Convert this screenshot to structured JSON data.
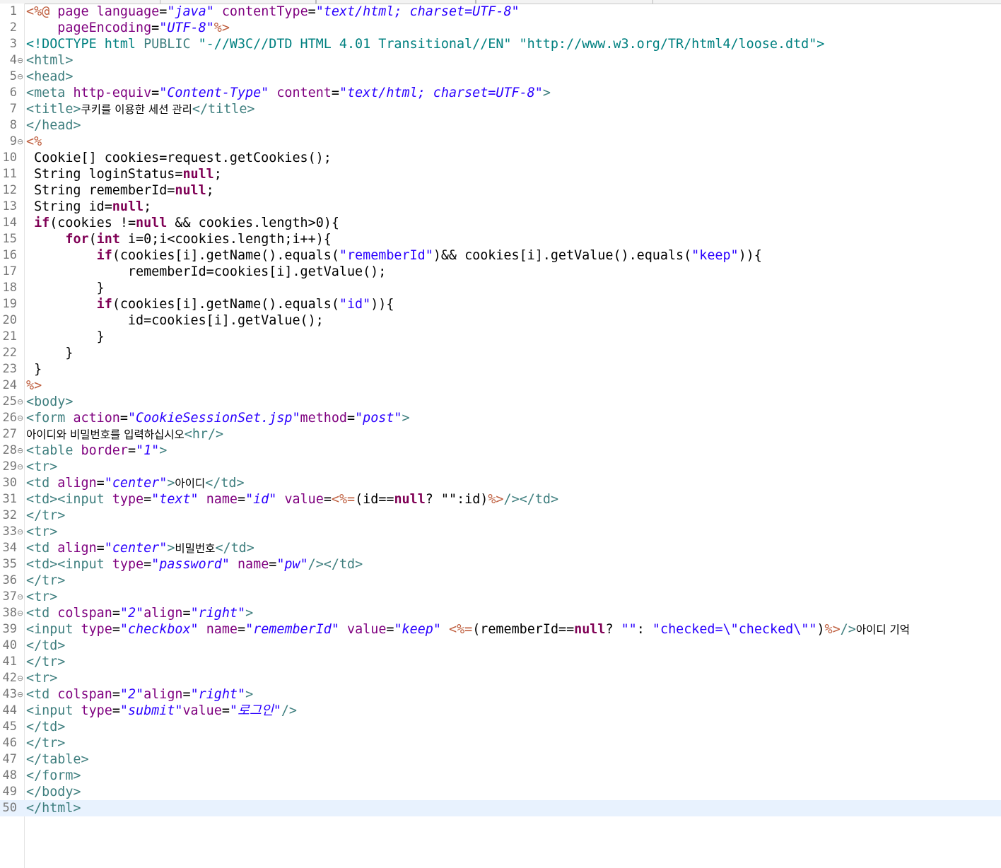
{
  "editor": {
    "lines": [
      {
        "n": "1",
        "fold": "",
        "segs": [
          [
            "j",
            "<%@"
          ],
          [
            "p",
            " "
          ],
          [
            "a",
            "page"
          ],
          [
            "p",
            " "
          ],
          [
            "a",
            "language"
          ],
          [
            "p",
            "="
          ],
          [
            "v",
            "\"java\""
          ],
          [
            "p",
            " "
          ],
          [
            "a",
            "contentType"
          ],
          [
            "p",
            "="
          ],
          [
            "v",
            "\"text/html; charset=UTF-8\""
          ]
        ]
      },
      {
        "n": "2",
        "fold": "",
        "segs": [
          [
            "p",
            "    "
          ],
          [
            "a",
            "pageEncoding"
          ],
          [
            "p",
            "="
          ],
          [
            "v",
            "\"UTF-8\""
          ],
          [
            "j",
            "%>"
          ]
        ]
      },
      {
        "n": "3",
        "fold": "",
        "segs": [
          [
            "d",
            "<!DOCTYPE html "
          ],
          [
            "t",
            "PUBLIC"
          ],
          [
            "d",
            " \"-//W3C//DTD HTML 4.01 Transitional//EN\" \"http://www.w3.org/TR/html4/loose.dtd\">"
          ]
        ]
      },
      {
        "n": "4",
        "fold": "⊖",
        "segs": [
          [
            "t",
            "<html>"
          ]
        ]
      },
      {
        "n": "5",
        "fold": "⊖",
        "segs": [
          [
            "t",
            "<head>"
          ]
        ]
      },
      {
        "n": "6",
        "fold": "",
        "segs": [
          [
            "t",
            "<meta "
          ],
          [
            "a",
            "http-equiv"
          ],
          [
            "p",
            "="
          ],
          [
            "v",
            "\"Content-Type\""
          ],
          [
            "p",
            " "
          ],
          [
            "a",
            "content"
          ],
          [
            "p",
            "="
          ],
          [
            "v",
            "\"text/html; charset=UTF-8\""
          ],
          [
            "t",
            ">"
          ]
        ]
      },
      {
        "n": "7",
        "fold": "",
        "segs": [
          [
            "t",
            "<title>"
          ],
          [
            "x",
            "쿠키를 이용한 세션 관리"
          ],
          [
            "t",
            "</title>"
          ]
        ]
      },
      {
        "n": "8",
        "fold": "",
        "segs": [
          [
            "t",
            "</head>"
          ]
        ]
      },
      {
        "n": "9",
        "fold": "⊖",
        "segs": [
          [
            "j",
            "<%"
          ]
        ]
      },
      {
        "n": "10",
        "fold": "",
        "segs": [
          [
            "p",
            " Cookie[] cookies=request.getCookies();"
          ]
        ]
      },
      {
        "n": "11",
        "fold": "",
        "segs": [
          [
            "p",
            " String loginStatus="
          ],
          [
            "k",
            "null"
          ],
          [
            "p",
            ";"
          ]
        ]
      },
      {
        "n": "12",
        "fold": "",
        "segs": [
          [
            "p",
            " String rememberId="
          ],
          [
            "k",
            "null"
          ],
          [
            "p",
            ";"
          ]
        ]
      },
      {
        "n": "13",
        "fold": "",
        "segs": [
          [
            "p",
            " String id="
          ],
          [
            "k",
            "null"
          ],
          [
            "p",
            ";"
          ]
        ]
      },
      {
        "n": "14",
        "fold": "",
        "segs": [
          [
            "p",
            " "
          ],
          [
            "k",
            "if"
          ],
          [
            "p",
            "(cookies !="
          ],
          [
            "k",
            "null"
          ],
          [
            "p",
            " && cookies.length>0){"
          ]
        ]
      },
      {
        "n": "15",
        "fold": "",
        "segs": [
          [
            "p",
            "     "
          ],
          [
            "k",
            "for"
          ],
          [
            "p",
            "("
          ],
          [
            "k",
            "int"
          ],
          [
            "p",
            " i=0;i<cookies.length;i++){"
          ]
        ]
      },
      {
        "n": "16",
        "fold": "",
        "segs": [
          [
            "p",
            "         "
          ],
          [
            "k",
            "if"
          ],
          [
            "p",
            "(cookies[i].getName().equals("
          ],
          [
            "s",
            "\"rememberId\""
          ],
          [
            "p",
            ")&& cookies[i].getValue().equals("
          ],
          [
            "s",
            "\"keep\""
          ],
          [
            "p",
            ")){"
          ]
        ]
      },
      {
        "n": "17",
        "fold": "",
        "segs": [
          [
            "p",
            "             rememberId=cookies[i].getValue();"
          ]
        ]
      },
      {
        "n": "18",
        "fold": "",
        "segs": [
          [
            "p",
            "         }"
          ]
        ]
      },
      {
        "n": "19",
        "fold": "",
        "segs": [
          [
            "p",
            "         "
          ],
          [
            "k",
            "if"
          ],
          [
            "p",
            "(cookies[i].getName().equals("
          ],
          [
            "s",
            "\"id\""
          ],
          [
            "p",
            ")){"
          ]
        ]
      },
      {
        "n": "20",
        "fold": "",
        "segs": [
          [
            "p",
            "             id=cookies[i].getValue();"
          ]
        ]
      },
      {
        "n": "21",
        "fold": "",
        "segs": [
          [
            "p",
            "         }"
          ]
        ]
      },
      {
        "n": "22",
        "fold": "",
        "segs": [
          [
            "p",
            "     }"
          ]
        ]
      },
      {
        "n": "23",
        "fold": "",
        "segs": [
          [
            "p",
            " }"
          ]
        ]
      },
      {
        "n": "24",
        "fold": "",
        "segs": [
          [
            "j",
            "%>"
          ]
        ]
      },
      {
        "n": "25",
        "fold": "⊖",
        "segs": [
          [
            "t",
            "<body>"
          ]
        ]
      },
      {
        "n": "26",
        "fold": "⊖",
        "segs": [
          [
            "t",
            "<form "
          ],
          [
            "a",
            "action"
          ],
          [
            "p",
            "="
          ],
          [
            "v",
            "\"CookieSessionSet.jsp\""
          ],
          [
            "a",
            "method"
          ],
          [
            "p",
            "="
          ],
          [
            "v",
            "\"post\""
          ],
          [
            "t",
            ">"
          ]
        ]
      },
      {
        "n": "27",
        "fold": "",
        "segs": [
          [
            "x",
            "아이디와 비밀번호를 입력하십시오"
          ],
          [
            "t",
            "<hr/>"
          ]
        ]
      },
      {
        "n": "28",
        "fold": "⊖",
        "segs": [
          [
            "t",
            "<table "
          ],
          [
            "a",
            "border"
          ],
          [
            "p",
            "="
          ],
          [
            "v",
            "\"1\""
          ],
          [
            "t",
            ">"
          ]
        ]
      },
      {
        "n": "29",
        "fold": "⊖",
        "segs": [
          [
            "t",
            "<tr>"
          ]
        ]
      },
      {
        "n": "30",
        "fold": "",
        "segs": [
          [
            "t",
            "<td "
          ],
          [
            "a",
            "align"
          ],
          [
            "p",
            "="
          ],
          [
            "v",
            "\"center\""
          ],
          [
            "t",
            ">"
          ],
          [
            "x",
            "아이디"
          ],
          [
            "t",
            "</td>"
          ]
        ]
      },
      {
        "n": "31",
        "fold": "",
        "segs": [
          [
            "t",
            "<td><input "
          ],
          [
            "a",
            "type"
          ],
          [
            "p",
            "="
          ],
          [
            "v",
            "\"text\""
          ],
          [
            "p",
            " "
          ],
          [
            "a",
            "name"
          ],
          [
            "p",
            "="
          ],
          [
            "v",
            "\"id\""
          ],
          [
            "p",
            " "
          ],
          [
            "a",
            "value"
          ],
          [
            "p",
            "="
          ],
          [
            "j",
            "<%="
          ],
          [
            "p",
            "(id=="
          ],
          [
            "k",
            "null"
          ],
          [
            "p",
            "? \"\":id)"
          ],
          [
            "j",
            "%>"
          ],
          [
            "t",
            "/></td>"
          ]
        ]
      },
      {
        "n": "32",
        "fold": "",
        "segs": [
          [
            "t",
            "</tr>"
          ]
        ]
      },
      {
        "n": "33",
        "fold": "⊖",
        "segs": [
          [
            "t",
            "<tr>"
          ]
        ]
      },
      {
        "n": "34",
        "fold": "",
        "segs": [
          [
            "t",
            "<td "
          ],
          [
            "a",
            "align"
          ],
          [
            "p",
            "="
          ],
          [
            "v",
            "\"center\""
          ],
          [
            "t",
            ">"
          ],
          [
            "x",
            "비밀번호"
          ],
          [
            "t",
            "</td>"
          ]
        ]
      },
      {
        "n": "35",
        "fold": "",
        "segs": [
          [
            "t",
            "<td><input "
          ],
          [
            "a",
            "type"
          ],
          [
            "p",
            "="
          ],
          [
            "v",
            "\"password\""
          ],
          [
            "p",
            " "
          ],
          [
            "a",
            "name"
          ],
          [
            "p",
            "="
          ],
          [
            "v",
            "\"pw\""
          ],
          [
            "t",
            "/></td>"
          ]
        ]
      },
      {
        "n": "36",
        "fold": "",
        "segs": [
          [
            "t",
            "</tr>"
          ]
        ]
      },
      {
        "n": "37",
        "fold": "⊖",
        "segs": [
          [
            "t",
            "<tr>"
          ]
        ]
      },
      {
        "n": "38",
        "fold": "⊖",
        "segs": [
          [
            "t",
            "<td "
          ],
          [
            "a",
            "colspan"
          ],
          [
            "p",
            "="
          ],
          [
            "v",
            "\"2\""
          ],
          [
            "a",
            "align"
          ],
          [
            "p",
            "="
          ],
          [
            "v",
            "\"right\""
          ],
          [
            "t",
            ">"
          ]
        ]
      },
      {
        "n": "39",
        "fold": "",
        "segs": [
          [
            "t",
            "<input "
          ],
          [
            "a",
            "type"
          ],
          [
            "p",
            "="
          ],
          [
            "v",
            "\"checkbox\""
          ],
          [
            "p",
            " "
          ],
          [
            "a",
            "name"
          ],
          [
            "p",
            "="
          ],
          [
            "v",
            "\"rememberId\""
          ],
          [
            "p",
            " "
          ],
          [
            "a",
            "value"
          ],
          [
            "p",
            "="
          ],
          [
            "v",
            "\"keep\""
          ],
          [
            "p",
            " "
          ],
          [
            "j",
            "<%="
          ],
          [
            "p",
            "(rememberId=="
          ],
          [
            "k",
            "null"
          ],
          [
            "p",
            "? "
          ],
          [
            "s",
            "\"\""
          ],
          [
            "p",
            ": "
          ],
          [
            "s",
            "\"checked=\\\"checked\\\"\""
          ],
          [
            "p",
            ")"
          ],
          [
            "j",
            "%>"
          ],
          [
            "t",
            "/>"
          ],
          [
            "x",
            "아이디 기억"
          ]
        ]
      },
      {
        "n": "40",
        "fold": "",
        "segs": [
          [
            "t",
            "</td>"
          ]
        ]
      },
      {
        "n": "41",
        "fold": "",
        "segs": [
          [
            "t",
            "</tr>"
          ]
        ]
      },
      {
        "n": "42",
        "fold": "⊖",
        "segs": [
          [
            "t",
            "<tr>"
          ]
        ]
      },
      {
        "n": "43",
        "fold": "⊖",
        "segs": [
          [
            "t",
            "<td "
          ],
          [
            "a",
            "colspan"
          ],
          [
            "p",
            "="
          ],
          [
            "v",
            "\"2\""
          ],
          [
            "a",
            "align"
          ],
          [
            "p",
            "="
          ],
          [
            "v",
            "\"right\""
          ],
          [
            "t",
            ">"
          ]
        ]
      },
      {
        "n": "44",
        "fold": "",
        "segs": [
          [
            "t",
            "<input "
          ],
          [
            "a",
            "type"
          ],
          [
            "p",
            "="
          ],
          [
            "v",
            "\"submit\""
          ],
          [
            "a",
            "value"
          ],
          [
            "p",
            "="
          ],
          [
            "v",
            "\"로그인\""
          ],
          [
            "t",
            "/>"
          ]
        ]
      },
      {
        "n": "45",
        "fold": "",
        "segs": [
          [
            "t",
            "</td>"
          ]
        ]
      },
      {
        "n": "46",
        "fold": "",
        "segs": [
          [
            "t",
            "</tr>"
          ]
        ]
      },
      {
        "n": "47",
        "fold": "",
        "segs": [
          [
            "t",
            "</table>"
          ]
        ]
      },
      {
        "n": "48",
        "fold": "",
        "segs": [
          [
            "t",
            "</form>"
          ]
        ]
      },
      {
        "n": "49",
        "fold": "",
        "segs": [
          [
            "t",
            "</body>"
          ]
        ]
      },
      {
        "n": "50",
        "fold": "",
        "current": true,
        "segs": [
          [
            "t",
            "</html>"
          ]
        ]
      }
    ]
  }
}
